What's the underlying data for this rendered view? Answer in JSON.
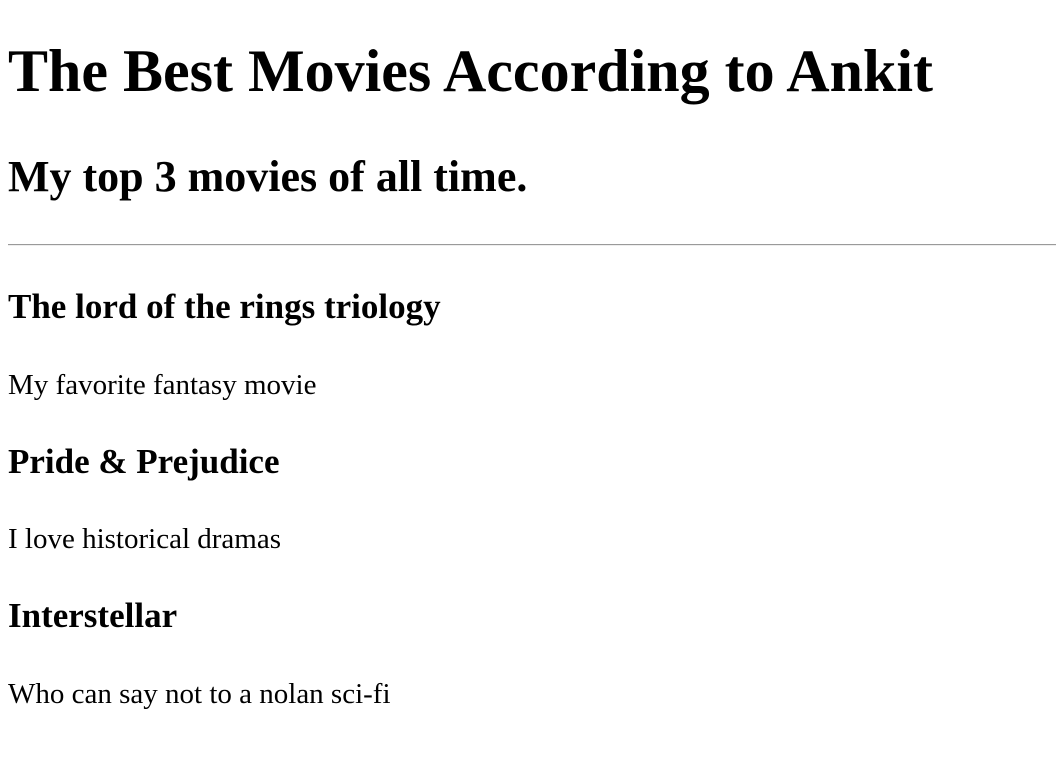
{
  "header": {
    "title": "The Best Movies According to Ankit",
    "subtitle": "My top 3 movies of all time."
  },
  "movies": [
    {
      "title": "The lord of the rings triology",
      "description": "My favorite fantasy movie"
    },
    {
      "title": "Pride & Prejudice",
      "description": "I love historical dramas"
    },
    {
      "title": "Interstellar",
      "description": "Who can say not to a nolan sci-fi"
    }
  ]
}
